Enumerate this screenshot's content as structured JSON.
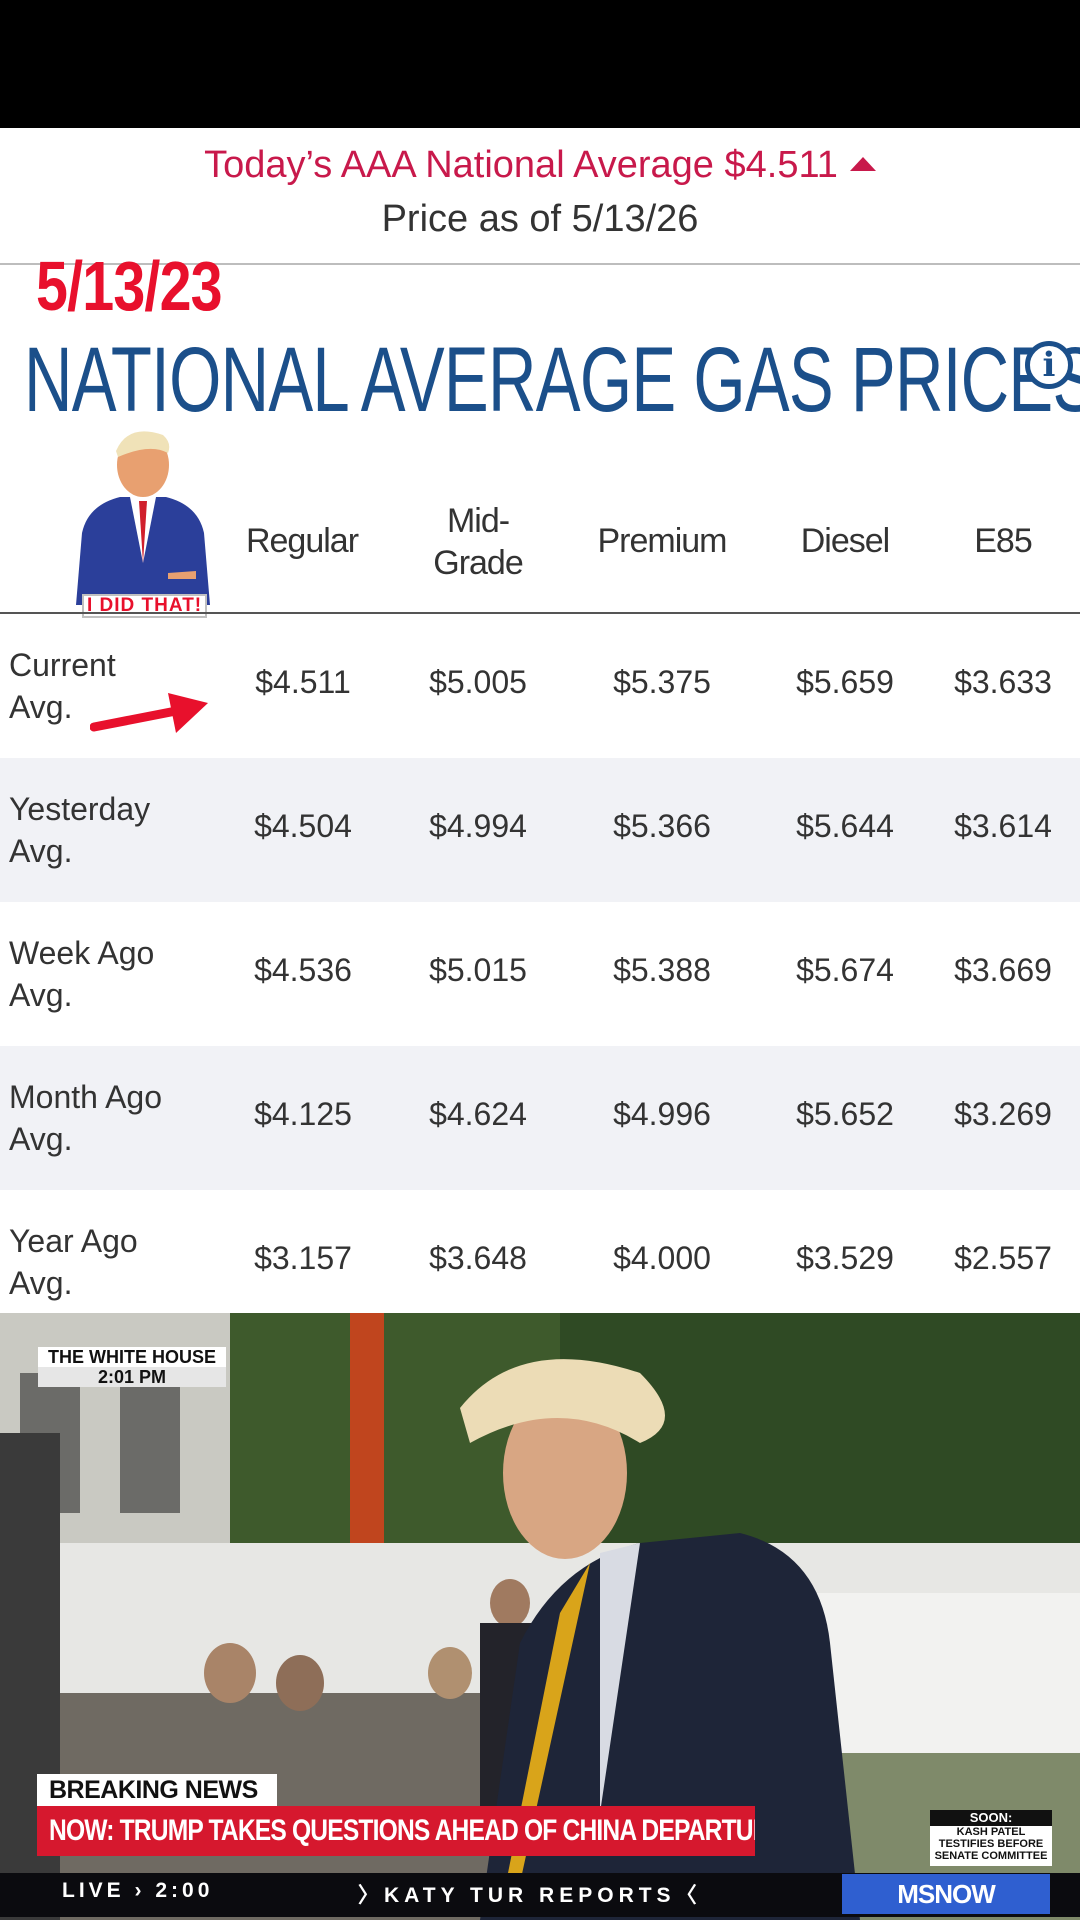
{
  "header": {
    "national_avg_text": "Today’s AAA National Average $4.511",
    "price_as_of": "Price as of 5/13/26"
  },
  "overlay": {
    "date_stamp": "5/13/23",
    "sticker_caption": "I DID THAT!"
  },
  "page_title": "NATIONAL AVERAGE GAS PRICES",
  "table": {
    "columns": [
      "Regular",
      "Mid-",
      "Grade",
      "Premium",
      "Diesel",
      "E85"
    ],
    "rows": [
      {
        "label1": "Current",
        "label2": "Avg.",
        "values": [
          "$4.511",
          "$5.005",
          "$5.375",
          "$5.659",
          "$3.633"
        ]
      },
      {
        "label1": "Yesterday",
        "label2": "Avg.",
        "values": [
          "$4.504",
          "$4.994",
          "$5.366",
          "$5.644",
          "$3.614"
        ]
      },
      {
        "label1": "Week Ago",
        "label2": "Avg.",
        "values": [
          "$4.536",
          "$5.015",
          "$5.388",
          "$5.674",
          "$3.669"
        ]
      },
      {
        "label1": "Month Ago",
        "label2": "Avg.",
        "values": [
          "$4.125",
          "$4.624",
          "$4.996",
          "$5.652",
          "$3.269"
        ]
      },
      {
        "label1": "Year Ago",
        "label2": "Avg.",
        "values": [
          "$3.157",
          "$3.648",
          "$4.000",
          "$3.529",
          "$2.557"
        ]
      }
    ]
  },
  "broadcast": {
    "location_line1": "THE WHITE HOUSE",
    "location_line2": "2:01 PM",
    "breaking_label": "BREAKING NEWS",
    "headline": "NOW: TRUMP TAKES QUESTIONS AHEAD OF CHINA DEPARTURE",
    "soon_label": "SOON:",
    "soon_text1": "KASH PATEL",
    "soon_text2": "TESTIFIES BEFORE",
    "soon_text3": "SENATE COMMITTEE",
    "live_text": "LIVE › 2:00",
    "show_text": "〉KATY TUR REPORTS〈",
    "network": "MSNOW"
  },
  "colors": {
    "accent_red": "#c8194b",
    "title_blue": "#1b4f8a",
    "banner_red": "#d6182e"
  }
}
